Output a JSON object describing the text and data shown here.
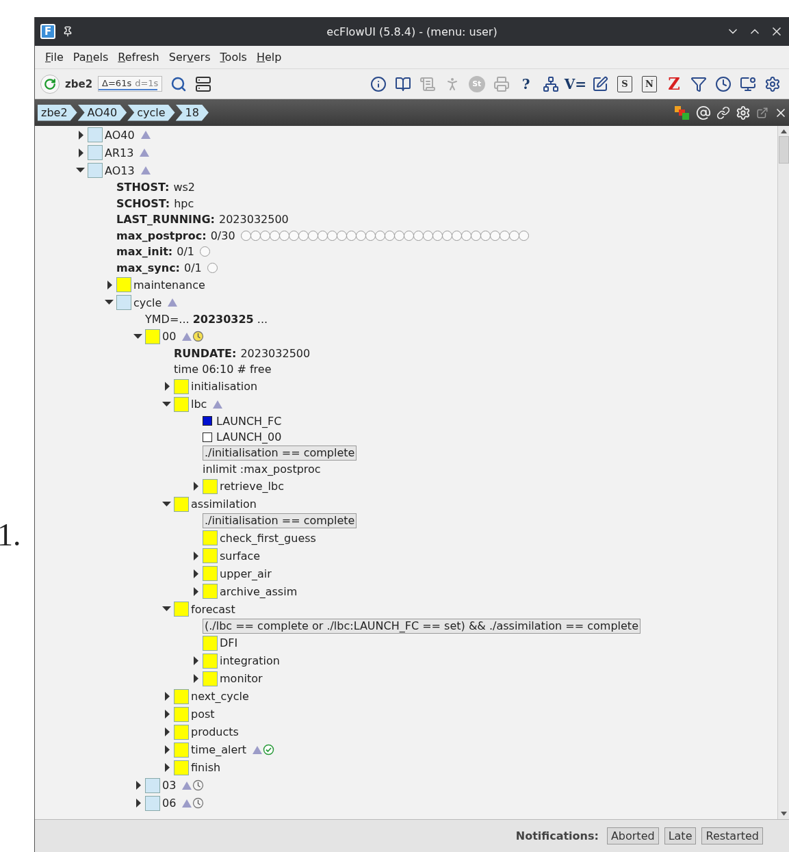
{
  "page_label": "1.",
  "window": {
    "app_icon_glyph": "F",
    "title": "ecFlowUI (5.8.4) - (menu: user)"
  },
  "menu": [
    {
      "key": "F",
      "post": "ile"
    },
    {
      "pre": "Pa",
      "key": "n",
      "post": "els"
    },
    {
      "key": "R",
      "post": "efresh"
    },
    {
      "pre": "Ser",
      "key": "v",
      "post": "ers"
    },
    {
      "key": "T",
      "post": "ools"
    },
    {
      "key": "H",
      "post": "elp"
    }
  ],
  "server_bar": {
    "server": "zbe2",
    "timing": "Δ=61s",
    "delta": "d=1s",
    "level": 0.93
  },
  "toolbar": [
    {
      "kind": "info",
      "disabled": false
    },
    {
      "kind": "book",
      "disabled": false
    },
    {
      "kind": "script",
      "disabled": true
    },
    {
      "kind": "run",
      "disabled": true
    },
    {
      "kind": "circle-glyph",
      "glyph": "St",
      "disabled": true
    },
    {
      "kind": "print",
      "disabled": true
    },
    {
      "kind": "glyph",
      "glyph": "?",
      "disabled": false
    },
    {
      "kind": "tree",
      "disabled": false
    },
    {
      "kind": "glyph",
      "glyph": "V=",
      "disabled": false
    },
    {
      "kind": "edit",
      "disabled": false
    },
    {
      "kind": "boxed-glyph",
      "glyph": "S",
      "disabled": false
    },
    {
      "kind": "boxed-glyph",
      "glyph": "N",
      "disabled": false
    },
    {
      "kind": "red-glyph",
      "glyph": "Z",
      "disabled": false
    },
    {
      "kind": "filter",
      "disabled": false
    },
    {
      "kind": "clock",
      "disabled": false
    },
    {
      "kind": "monitor",
      "disabled": false
    },
    {
      "kind": "gear",
      "disabled": false
    }
  ],
  "breadcrumb": [
    "zbe2",
    "AO40",
    "cycle",
    "18"
  ],
  "tree": {
    "items": [
      {
        "kind": "node",
        "name": "AO40",
        "color": "#cfe7f5",
        "expanded": false,
        "markers": [
          {
            "kind": "trigger"
          }
        ]
      },
      {
        "kind": "node",
        "name": "AR13",
        "color": "#cfe7f5",
        "expanded": false,
        "markers": [
          {
            "kind": "trigger"
          }
        ]
      },
      {
        "kind": "node",
        "name": "AO13",
        "color": "#cfe7f5",
        "expanded": true,
        "markers": [
          {
            "kind": "trigger"
          }
        ],
        "children": [
          {
            "kind": "variable",
            "name": "STHOST:",
            "value": "ws2"
          },
          {
            "kind": "variable",
            "name": "SCHOST:",
            "value": "hpc"
          },
          {
            "kind": "variable",
            "name": "LAST_RUNNING:",
            "value": "2023032500"
          },
          {
            "kind": "limit",
            "name": "max_postproc:",
            "value": "0/30"
          },
          {
            "kind": "limit",
            "name": "max_init:",
            "value": "0/1"
          },
          {
            "kind": "limit",
            "name": "max_sync:",
            "value": "0/1"
          },
          {
            "kind": "node",
            "name": "maintenance",
            "color": "#ffff00",
            "expanded": false
          },
          {
            "kind": "node",
            "name": "cycle",
            "color": "#cfe7f5",
            "expanded": true,
            "markers": [
              {
                "kind": "trigger"
              }
            ],
            "children": [
              {
                "kind": "repeat",
                "text": "YMD=... **20230325** ..."
              },
              {
                "kind": "node",
                "name": "00",
                "color": "#ffff00",
                "expanded": true,
                "markers": [
                  {
                    "kind": "trigger"
                  },
                  {
                    "kind": "clock",
                    "active": true
                  }
                ],
                "children": [
                  {
                    "kind": "variable",
                    "name": "RUNDATE:",
                    "value": "2023032500"
                  },
                  {
                    "kind": "time",
                    "text": "time 06:10 # free"
                  },
                  {
                    "kind": "node",
                    "name": "initialisation",
                    "color": "#ffff00",
                    "expanded": false
                  },
                  {
                    "kind": "node",
                    "name": "lbc",
                    "color": "#ffff00",
                    "expanded": true,
                    "markers": [
                      {
                        "kind": "trigger"
                      }
                    ],
                    "children": [
                      {
                        "kind": "event",
                        "name": "LAUNCH_FC",
                        "set": true
                      },
                      {
                        "kind": "event",
                        "name": "LAUNCH_00",
                        "set": false
                      },
                      {
                        "kind": "trigger",
                        "text": "./initialisation == complete"
                      },
                      {
                        "kind": "inlimit",
                        "text": "inlimit :max_postproc"
                      },
                      {
                        "kind": "node",
                        "name": "retrieve_lbc",
                        "color": "#ffff00",
                        "expanded": false
                      }
                    ]
                  },
                  {
                    "kind": "node",
                    "name": "assimilation",
                    "color": "#ffff00",
                    "expanded": true,
                    "children": [
                      {
                        "kind": "trigger",
                        "text": "./initialisation == complete"
                      },
                      {
                        "kind": "leaf",
                        "name": "check_first_guess",
                        "color": "#ffff00"
                      },
                      {
                        "kind": "node",
                        "name": "surface",
                        "color": "#ffff00",
                        "expanded": false
                      },
                      {
                        "kind": "node",
                        "name": "upper_air",
                        "color": "#ffff00",
                        "expanded": false
                      },
                      {
                        "kind": "node",
                        "name": "archive_assim",
                        "color": "#ffff00",
                        "expanded": false
                      }
                    ]
                  },
                  {
                    "kind": "node",
                    "name": "forecast",
                    "color": "#ffff00",
                    "expanded": true,
                    "children": [
                      {
                        "kind": "trigger",
                        "text": "(./lbc == complete or ./lbc:LAUNCH_FC == set) && ./assimilation == complete"
                      },
                      {
                        "kind": "leaf",
                        "name": "DFI",
                        "color": "#ffff00"
                      },
                      {
                        "kind": "node",
                        "name": "integration",
                        "color": "#ffff00",
                        "expanded": false
                      },
                      {
                        "kind": "node",
                        "name": "monitor",
                        "color": "#ffff00",
                        "expanded": false
                      }
                    ]
                  },
                  {
                    "kind": "node",
                    "name": "next_cycle",
                    "color": "#ffff00",
                    "expanded": false
                  },
                  {
                    "kind": "node",
                    "name": "post",
                    "color": "#ffff00",
                    "expanded": false
                  },
                  {
                    "kind": "node",
                    "name": "products",
                    "color": "#ffff00",
                    "expanded": false
                  },
                  {
                    "kind": "node",
                    "name": "time_alert",
                    "color": "#ffff00",
                    "expanded": false,
                    "markers": [
                      {
                        "kind": "trigger"
                      },
                      {
                        "kind": "check"
                      }
                    ]
                  },
                  {
                    "kind": "node",
                    "name": "finish",
                    "color": "#ffff00",
                    "expanded": false
                  }
                ]
              },
              {
                "kind": "node",
                "name": "03",
                "color": "#cfe7f5",
                "expanded": false,
                "markers": [
                  {
                    "kind": "trigger"
                  },
                  {
                    "kind": "clock",
                    "active": false
                  }
                ]
              },
              {
                "kind": "node",
                "name": "06",
                "color": "#cfe7f5",
                "expanded": false,
                "markers": [
                  {
                    "kind": "trigger"
                  },
                  {
                    "kind": "clock",
                    "active": false
                  }
                ]
              }
            ]
          }
        ]
      }
    ]
  },
  "status_bar": {
    "label": "Notifications:",
    "buttons": [
      "Aborted",
      "Late",
      "Restarted"
    ]
  }
}
